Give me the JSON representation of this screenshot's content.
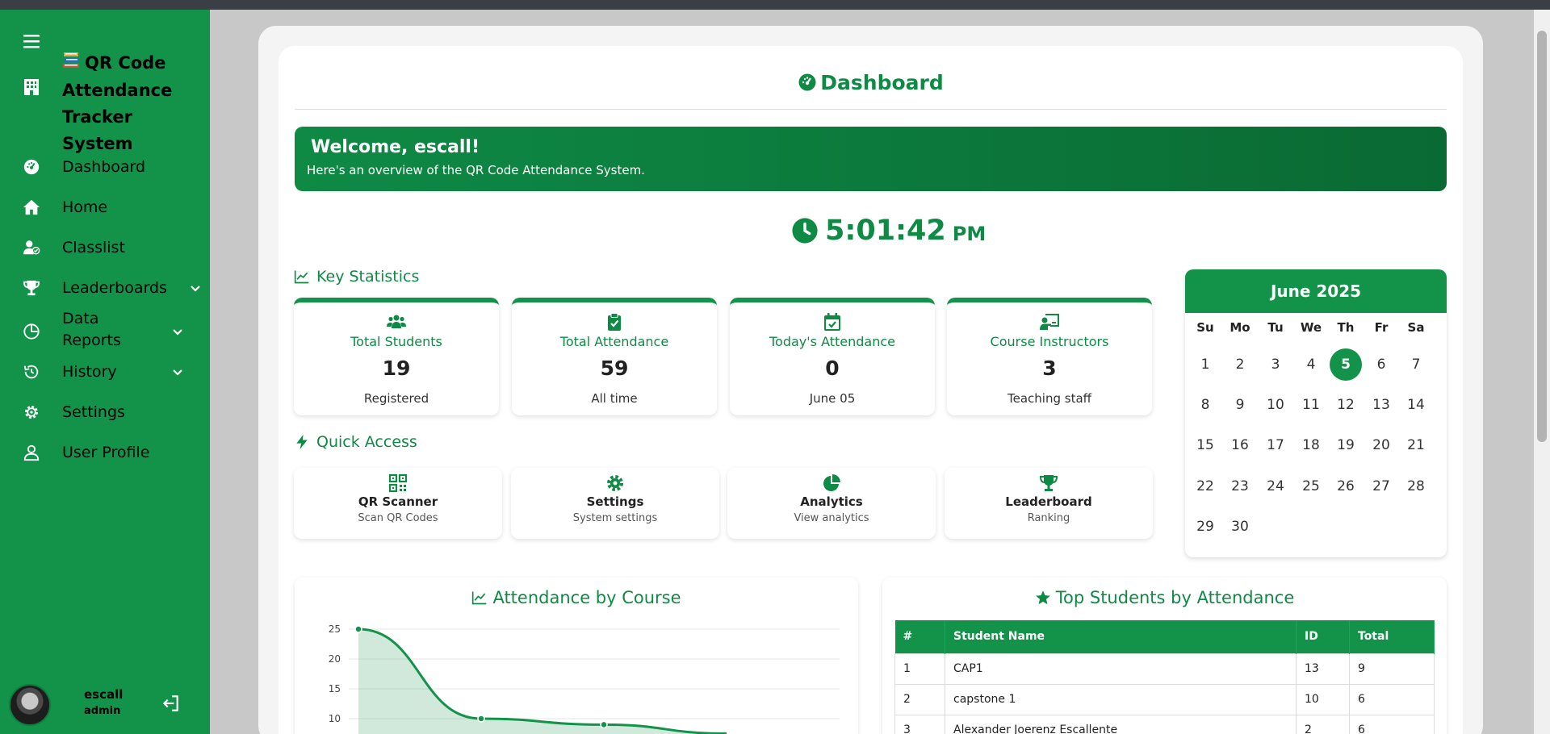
{
  "app": {
    "title_line1": "QR Code",
    "title_line2": "Attendance",
    "title_line3": "Tracker System"
  },
  "sidebar": {
    "items": [
      {
        "label": "Dashboard",
        "icon": "gauge-icon"
      },
      {
        "label": "Home",
        "icon": "home-icon"
      },
      {
        "label": "Classlist",
        "icon": "user-check-icon"
      },
      {
        "label": "Leaderboards",
        "icon": "trophy-icon",
        "expandable": true
      },
      {
        "label_line1": "Data",
        "label_line2": "Reports",
        "icon": "chart-pie-icon",
        "expandable": true
      },
      {
        "label": "History",
        "icon": "history-icon",
        "expandable": true
      },
      {
        "label": "Settings",
        "icon": "gear-icon"
      },
      {
        "label": "User Profile",
        "icon": "user-icon"
      }
    ],
    "user": {
      "name": "escall",
      "role": "admin"
    }
  },
  "page": {
    "title": "Dashboard",
    "welcome_heading": "Welcome, escall!",
    "welcome_text": "Here's an overview of the QR Code Attendance System.",
    "clock_time": "5:01:42",
    "clock_ampm": "PM"
  },
  "key_stats": {
    "heading": "Key Statistics",
    "cards": [
      {
        "label": "Total Students",
        "value": "19",
        "sub": "Registered",
        "icon": "users-icon"
      },
      {
        "label": "Total Attendance",
        "value": "59",
        "sub": "All time",
        "icon": "clipboard-check-icon"
      },
      {
        "label": "Today's Attendance",
        "value": "0",
        "sub": "June 05",
        "icon": "calendar-check-icon"
      },
      {
        "label": "Course Instructors",
        "value": "3",
        "sub": "Teaching staff",
        "icon": "chalkboard-teacher-icon"
      }
    ]
  },
  "quick_access": {
    "heading": "Quick Access",
    "items": [
      {
        "title": "QR Scanner",
        "sub": "Scan QR Codes",
        "icon": "qrcode-icon"
      },
      {
        "title": "Settings",
        "sub": "System settings",
        "icon": "gear-icon"
      },
      {
        "title": "Analytics",
        "sub": "View analytics",
        "icon": "chart-pie-icon"
      },
      {
        "title": "Leaderboard",
        "sub": "Ranking",
        "icon": "trophy-icon"
      }
    ]
  },
  "calendar": {
    "month_label": "June 2025",
    "weekdays": [
      "Su",
      "Mo",
      "Tu",
      "We",
      "Th",
      "Fr",
      "Sa"
    ],
    "first_weekday_index": 0,
    "days_in_month": 30,
    "today": 5
  },
  "attendance_chart": {
    "title": "Attendance by Course",
    "chart_data": {
      "type": "area",
      "y_ticks": [
        25,
        20,
        15,
        10
      ],
      "ylim": [
        5,
        25
      ],
      "series": [
        {
          "values": [
            25,
            10,
            9,
            7.5
          ]
        }
      ],
      "color": "#13934a",
      "grid": true
    }
  },
  "top_students": {
    "title": "Top Students by Attendance",
    "columns": [
      "#",
      "Student Name",
      "ID",
      "Total"
    ],
    "rows": [
      [
        "1",
        "CAP1",
        "13",
        "9"
      ],
      [
        "2",
        "capstone 1",
        "10",
        "6"
      ],
      [
        "3",
        "Alexander Joerenz Escallente",
        "2",
        "6"
      ]
    ]
  },
  "colors": {
    "primary": "#13934a",
    "primary_dark": "#0a6a33"
  }
}
